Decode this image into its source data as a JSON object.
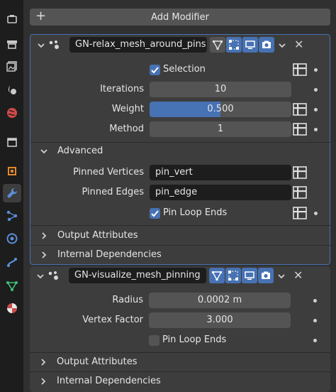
{
  "tabs": [
    {
      "icon": "tool-icon"
    },
    {
      "icon": "render-icon"
    },
    {
      "icon": "output-icon"
    },
    {
      "icon": "view-layer-icon"
    },
    {
      "icon": "scene-icon"
    },
    {
      "icon": "world-icon"
    },
    {
      "icon": "collection-icon"
    },
    {
      "icon": "object-icon"
    },
    {
      "icon": "modifier-wrench-icon",
      "active": true
    },
    {
      "icon": "particles-icon"
    },
    {
      "icon": "physics-icon"
    },
    {
      "icon": "constraints-icon"
    },
    {
      "icon": "data-icon"
    },
    {
      "icon": "material-icon"
    }
  ],
  "add_modifier": {
    "label": "Add Modifier"
  },
  "modifier1": {
    "name": "GN-relax_mesh_around_pins",
    "selection_label": "Selection",
    "selection_checked": true,
    "iterations_label": "Iterations",
    "iterations_value": "10",
    "weight_label": "Weight",
    "weight_value": "0.500",
    "weight_fraction": 0.5,
    "method_label": "Method",
    "method_value": "1",
    "advanced_label": "Advanced",
    "pinned_vertices_label": "Pinned Vertices",
    "pinned_vertices_value": "pin_vert",
    "pinned_edges_label": "Pinned Edges",
    "pinned_edges_value": "pin_edge",
    "pin_loop_ends_label": "Pin Loop Ends",
    "pin_loop_ends_checked": true,
    "output_attributes_label": "Output Attributes",
    "internal_dependencies_label": "Internal Dependencies"
  },
  "modifier2": {
    "name": "GN-visualize_mesh_pinning",
    "radius_label": "Radius",
    "radius_value": "0.0002 m",
    "vertex_factor_label": "Vertex Factor",
    "vertex_factor_value": "3.000",
    "pin_loop_ends_label": "Pin Loop Ends",
    "pin_loop_ends_checked": false,
    "output_attributes_label": "Output Attributes",
    "internal_dependencies_label": "Internal Dependencies"
  },
  "colors": {
    "accent": "#4772b3",
    "panel_bg": "#3d3d3d",
    "field_bg": "#545454",
    "text_field_bg": "#1d1d1d"
  }
}
